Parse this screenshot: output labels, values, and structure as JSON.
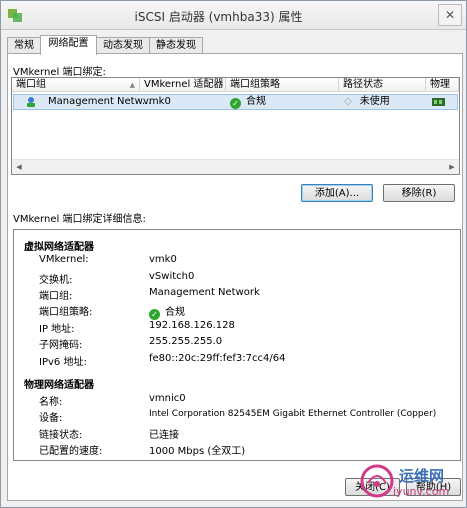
{
  "window": {
    "title": "iSCSI 启动器 (vmhba33) 属性",
    "close": "✕"
  },
  "tabs": [
    "常规",
    "网络配置",
    "动态发现",
    "静态发现"
  ],
  "binding": {
    "label": "VMkernel 端口绑定:",
    "columns": [
      "端口组",
      "VMkernel 适配器",
      "端口组策略",
      "路径状态",
      "物理"
    ],
    "row": {
      "port_group": "Management Netw...",
      "adapter": "vmk0",
      "policy": "合规",
      "path_status": "未使用"
    }
  },
  "buttons": {
    "add": "添加(A)...",
    "remove": "移除(R)",
    "close": "关闭(C)",
    "help": "帮助(H)"
  },
  "details": {
    "label": "VMkernel 端口绑定详细信息:",
    "virtual_header": "虚拟网络适配器",
    "virtual": {
      "vmkernel_k": "VMkernel:",
      "vmkernel_v": "vmk0",
      "switch_k": "交换机:",
      "switch_v": "vSwitch0",
      "portgroup_k": "端口组:",
      "portgroup_v": "Management Network",
      "policy_k": "端口组策略:",
      "policy_v": "合规",
      "ip_k": "IP 地址:",
      "ip_v": "192.168.126.128",
      "mask_k": "子网掩码:",
      "mask_v": "255.255.255.0",
      "ipv6_k": "IPv6 地址:",
      "ipv6_v": "fe80::20c:29ff:fef3:7cc4/64"
    },
    "physical_header": "物理网络适配器",
    "physical": {
      "name_k": "名称:",
      "name_v": "vmnic0",
      "device_k": "设备:",
      "device_v": "Intel Corporation 82545EM Gigabit Ethernet Controller (Copper)",
      "link_k": "链接状态:",
      "link_v": "已连接",
      "speed_k": "已配置的速度:",
      "speed_v": "1000 Mbps (全双工)"
    }
  },
  "watermark": {
    "text": "运维网",
    "url": "iyunv.com"
  },
  "colors": {
    "accent": "#3c7fb1",
    "ok": "#2ea52e",
    "selection": "#dbe9f7"
  }
}
